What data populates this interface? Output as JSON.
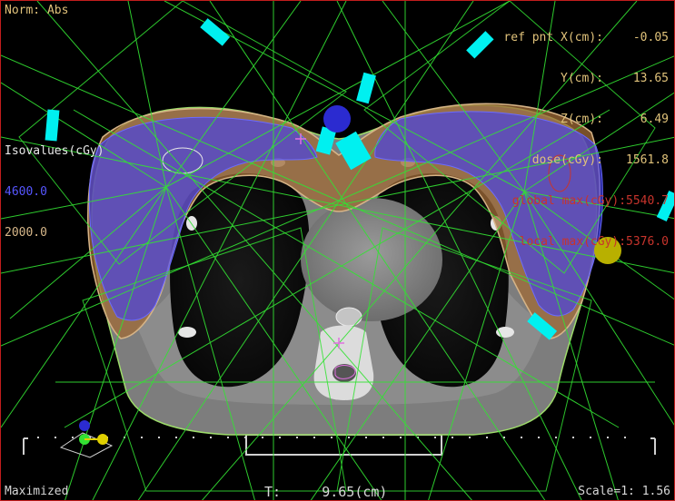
{
  "viewer": {
    "dose_mode": "Norm: Abs",
    "window_state": "Maximized",
    "slice_position": "T:     9.65(cm)",
    "scale": "Scale=1: 1.56"
  },
  "ref_point": {
    "x_label": "ref pnt X(cm):",
    "x_value": "-0.05",
    "y_label": "Y(cm):",
    "y_value": "13.65",
    "z_label": "Z(cm):",
    "z_value": "6.49",
    "dose_label": "dose(cGy):",
    "dose_value": "1561.8",
    "global_max_label": "global max(cGy):",
    "global_max_value": "5540.7",
    "local_max_label": "local max(cGy):",
    "local_max_value": "5376.0"
  },
  "isovalues": {
    "title": "Isovalues(cGy)",
    "levels": [
      {
        "value": "4600.0",
        "color": "#4a4aff"
      },
      {
        "value": "2000.0",
        "color": "#c9a06a"
      }
    ]
  },
  "colors": {
    "frame_border": "#c21d1d",
    "beam_lines": "#33e233",
    "isocenter_markers": "#00f0f0",
    "body_contour": "#9ddc6a",
    "dose_high": "#4a4aff",
    "dose_low": "#c9a06a",
    "reference_point": "#2b2bd0",
    "marker_yellow": "#b8b000",
    "poi_magenta": "#e070e0"
  },
  "icons": {
    "reference_point": "blue-circle-marker",
    "marker": "yellow-circle-marker",
    "poi": "magenta-cross-marker",
    "orientation": "orientation-axes-icon"
  }
}
